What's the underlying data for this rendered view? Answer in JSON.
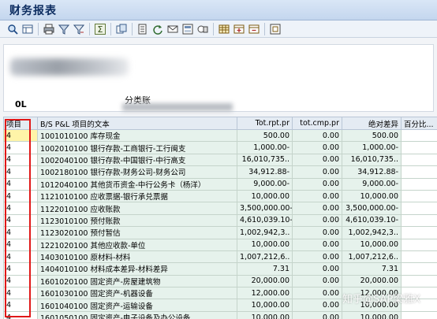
{
  "window": {
    "title": "财务报表"
  },
  "toolbar": {
    "icons": [
      "zoom-icon",
      "layout-icon",
      "print-icon",
      "filter-icon",
      "filter-options-icon",
      "sum-icon",
      "subtotal-icon",
      "export-icon",
      "refresh-icon",
      "mail-icon",
      "select-layout-icon",
      "graph-icon",
      "grid-icon",
      "expand-icon",
      "collapse-icon",
      "window-icon"
    ]
  },
  "header": {
    "code": "0L",
    "label": "分类账"
  },
  "table": {
    "columns": [
      "项目",
      "B/S P&L 项目的文本",
      "Tot.rpt.pr",
      "tot.cmp.pr",
      "绝对差异",
      "百分比..."
    ],
    "rows": [
      {
        "item": "4",
        "text": "1001010100 库存现金",
        "rpt": "500.00",
        "cmp": "0.00",
        "diff": "500.00",
        "pct": ""
      },
      {
        "item": "4",
        "text": "1002010100 银行存款-工商银行-工行闽支",
        "rpt": "1,000.00-",
        "cmp": "0.00",
        "diff": "1,000.00-",
        "pct": ""
      },
      {
        "item": "4",
        "text": "1002040100 银行存款-中国银行-中行高支",
        "rpt": "16,010,735..",
        "cmp": "0.00",
        "diff": "16,010,735..",
        "pct": ""
      },
      {
        "item": "4",
        "text": "1002180100 银行存款-财务公司-财务公司",
        "rpt": "34,912.88-",
        "cmp": "0.00",
        "diff": "34,912.88-",
        "pct": ""
      },
      {
        "item": "4",
        "text": "1012040100 其他货币资金-中行公务卡（杨洋）",
        "rpt": "9,000.00-",
        "cmp": "0.00",
        "diff": "9,000.00-",
        "pct": ""
      },
      {
        "item": "4",
        "text": "1121010100 应收票据-银行承兑票据",
        "rpt": "10,000.00",
        "cmp": "0.00",
        "diff": "10,000.00",
        "pct": ""
      },
      {
        "item": "4",
        "text": "1122010100 应收账款",
        "rpt": "3,500,000.00-",
        "cmp": "0.00",
        "diff": "3,500,000.00-",
        "pct": ""
      },
      {
        "item": "4",
        "text": "1123010100 预付账款",
        "rpt": "4,610,039.10-",
        "cmp": "0.00",
        "diff": "4,610,039.10-",
        "pct": ""
      },
      {
        "item": "4",
        "text": "1123020100 预付暂估",
        "rpt": "1,002,942,3..",
        "cmp": "0.00",
        "diff": "1,002,942,3..",
        "pct": ""
      },
      {
        "item": "4",
        "text": "1221020100 其他应收款-单位",
        "rpt": "10,000.00",
        "cmp": "0.00",
        "diff": "10,000.00",
        "pct": ""
      },
      {
        "item": "4",
        "text": "1403010100 原材料-材料",
        "rpt": "1,007,212,6..",
        "cmp": "0.00",
        "diff": "1,007,212,6..",
        "pct": ""
      },
      {
        "item": "4",
        "text": "1404010100 材料成本差异-材料差异",
        "rpt": "7.31",
        "cmp": "0.00",
        "diff": "7.31",
        "pct": ""
      },
      {
        "item": "4",
        "text": "1601020100 固定资产-房屋建筑物",
        "rpt": "20,000.00",
        "cmp": "0.00",
        "diff": "20,000.00",
        "pct": ""
      },
      {
        "item": "4",
        "text": "1601030100 固定资产-机器设备",
        "rpt": "12,000.00",
        "cmp": "0.00",
        "diff": "12,000.00",
        "pct": ""
      },
      {
        "item": "4",
        "text": "1601040100 固定资产-运输设备",
        "rpt": "10,000.00",
        "cmp": "0.00",
        "diff": "10,000.00",
        "pct": ""
      },
      {
        "item": "4",
        "text": "1601050100 固定资产-电子设备及办公设备",
        "rpt": "10,000.00",
        "cmp": "0.00",
        "diff": "10,000.00",
        "pct": ""
      }
    ]
  },
  "watermark": {
    "text": "知乎@SAP梁雅X"
  },
  "colors": {
    "highlight": "#e01818",
    "selected_cell": "#fff4a8",
    "data_cell": "#e6f2ec",
    "title": "#0c2c60"
  }
}
